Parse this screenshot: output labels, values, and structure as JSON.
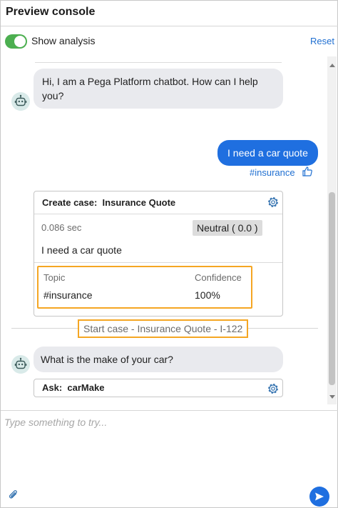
{
  "header": {
    "title": "Preview console"
  },
  "toolbar": {
    "toggle_label": "Show analysis",
    "toggle_on": true,
    "reset_label": "Reset"
  },
  "colors": {
    "accent": "#1f6fe0",
    "toggle_on": "#4caf50",
    "highlight": "#f5a623",
    "bot_bubble": "#e9eaee"
  },
  "chat": {
    "messages": [
      {
        "sender": "bot",
        "text": "Hi, I am a Pega Platform chatbot. How can I help you?"
      },
      {
        "sender": "user",
        "text": "I need a car quote",
        "tag": "#insurance"
      },
      {
        "sender": "bot",
        "text": "What is the make of your car?"
      }
    ],
    "analysis_card": {
      "title": "Create case:  Insurance Quote",
      "time": "0.086 sec",
      "sentiment": "Neutral ( 0.0 )",
      "utterance": "I need a car quote",
      "topic_header": "Topic",
      "confidence_header": "Confidence",
      "topic_value": "#insurance",
      "confidence_value": "100%"
    },
    "case_started": "Start case - Insurance Quote - I-122",
    "ask_card": {
      "title": "Ask:  carMake"
    }
  },
  "input": {
    "placeholder": "Type something to try..."
  },
  "icons": {
    "bot": "robot-icon",
    "feedback": "thumbs-up-icon",
    "settings": "gear-icon",
    "attach": "paperclip-icon",
    "send": "send-icon"
  }
}
